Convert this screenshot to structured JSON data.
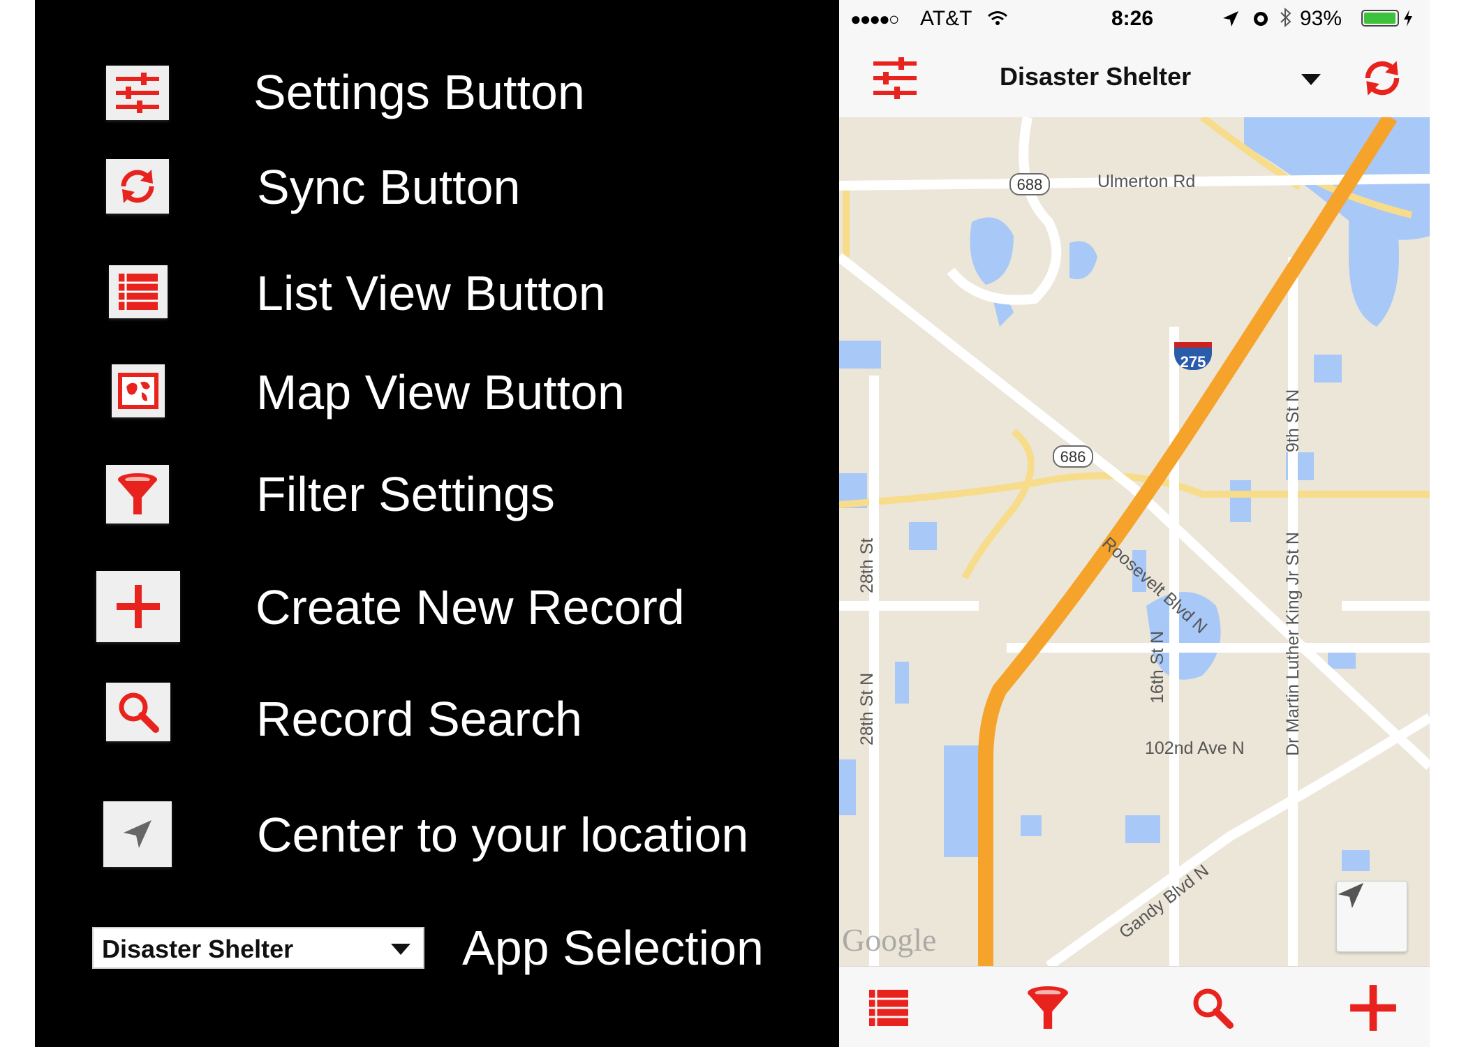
{
  "colors": {
    "accent": "#e8231e",
    "legend_bg": "#000000",
    "map_land": "#ece6d8",
    "water": "#a8c8f8",
    "highway": "#f6a32b"
  },
  "legend": {
    "items": [
      {
        "icon": "settings-sliders-icon",
        "label": "Settings Button"
      },
      {
        "icon": "sync-icon",
        "label": "Sync Button"
      },
      {
        "icon": "list-view-icon",
        "label": "List View Button"
      },
      {
        "icon": "map-view-icon",
        "label": "Map View Button"
      },
      {
        "icon": "filter-funnel-icon",
        "label": "Filter Settings"
      },
      {
        "icon": "plus-icon",
        "label": "Create New Record"
      },
      {
        "icon": "search-magnifier-icon",
        "label": "Record Search"
      },
      {
        "icon": "location-arrow-icon",
        "label": "Center to your location"
      }
    ],
    "app_select": {
      "value": "Disaster Shelter",
      "label": "App Selection"
    }
  },
  "phone": {
    "status": {
      "signal": "●●●●○",
      "carrier": "AT&T",
      "time": "8:26",
      "battery": "93%"
    },
    "navbar": {
      "title": "Disaster Shelter"
    },
    "map": {
      "roads": {
        "ulmerton": "Ulmerton Rd",
        "roosevelt": "Roosevelt Blvd N",
        "st9": "9th St N",
        "mlk": "Dr Martin Luther King Jr St N",
        "st16": "16th St N",
        "st28a": "28th St",
        "st28b": "28th St N",
        "ave102": "102nd Ave N",
        "gandy": "Gandy Blvd N"
      },
      "shields": {
        "s688": "688",
        "s686": "686",
        "i275": "275"
      },
      "attribution": "Google"
    }
  }
}
